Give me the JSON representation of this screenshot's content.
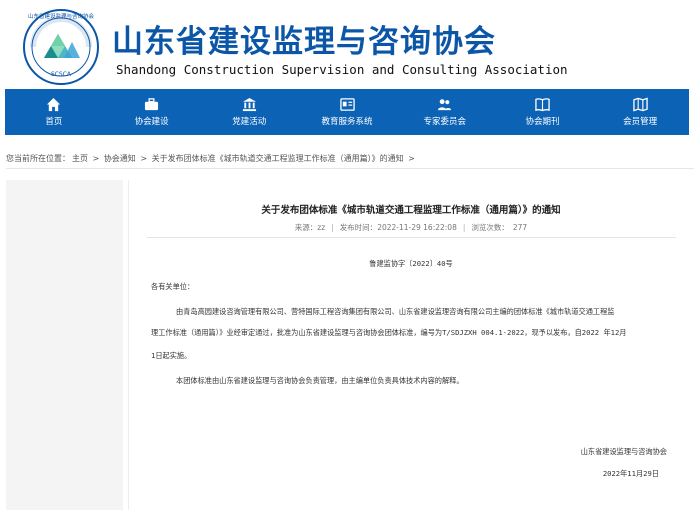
{
  "header": {
    "title_cn": "山东省建设监理与咨询协会",
    "title_en": "Shandong Construction Supervision and Consulting Association",
    "logo_text": "山东省建设监理与咨询协会",
    "logo_abbr": "SCSCA"
  },
  "nav": {
    "items": [
      {
        "label": "首页",
        "icon": "home-icon"
      },
      {
        "label": "协会建设",
        "icon": "briefcase-icon"
      },
      {
        "label": "党建活动",
        "icon": "bank-icon"
      },
      {
        "label": "教育服务系统",
        "icon": "id-card-icon"
      },
      {
        "label": "专家委员会",
        "icon": "users-icon"
      },
      {
        "label": "协会期刊",
        "icon": "book-icon"
      },
      {
        "label": "会员管理",
        "icon": "map-icon"
      }
    ]
  },
  "breadcrumb": {
    "prefix": "您当前所在位置：",
    "items": [
      "主页",
      "协会通知",
      "关于发布团体标准《城市轨道交通工程监理工作标准（通用篇）》的通知"
    ],
    "separator": ">"
  },
  "article": {
    "title": "关于发布团体标准《城市轨道交通工程监理工作标准（通用篇）》的通知",
    "meta": {
      "source_label": "来源：",
      "source": "zz",
      "time_label": "发布时间：",
      "time": "2022-11-29 16:22:08",
      "views_label": "浏览次数：",
      "views": "277"
    },
    "doc_number": "鲁建监协字〔2022〕40号",
    "salutation": "各有关单位：",
    "para1_line1": "由青岛高园建设咨询管理有限公司、营特国际工程咨询集团有限公司、山东省建设监理咨询有限公司主编的团体标准《城市轨道交通工程监",
    "para1_line2": "理工作标准（通用篇）》业经审定通过，批准为山东省建设监理与咨询协会团体标准，编号为T/SDJZXH 004.1-2022，现予以发布，自2022 年12月",
    "para1_line3": "1日起实施。",
    "para2": "本团体标准由山东省建设监理与咨询协会负责管理，由主编单位负责具体技术内容的解释。",
    "signature": "山东省建设监理与咨询协会",
    "date": "2022年11月29日"
  },
  "colors": {
    "brand_blue": "#0c56a8",
    "nav_blue": "#0c62b5",
    "logo_green": "#2aa87a"
  }
}
